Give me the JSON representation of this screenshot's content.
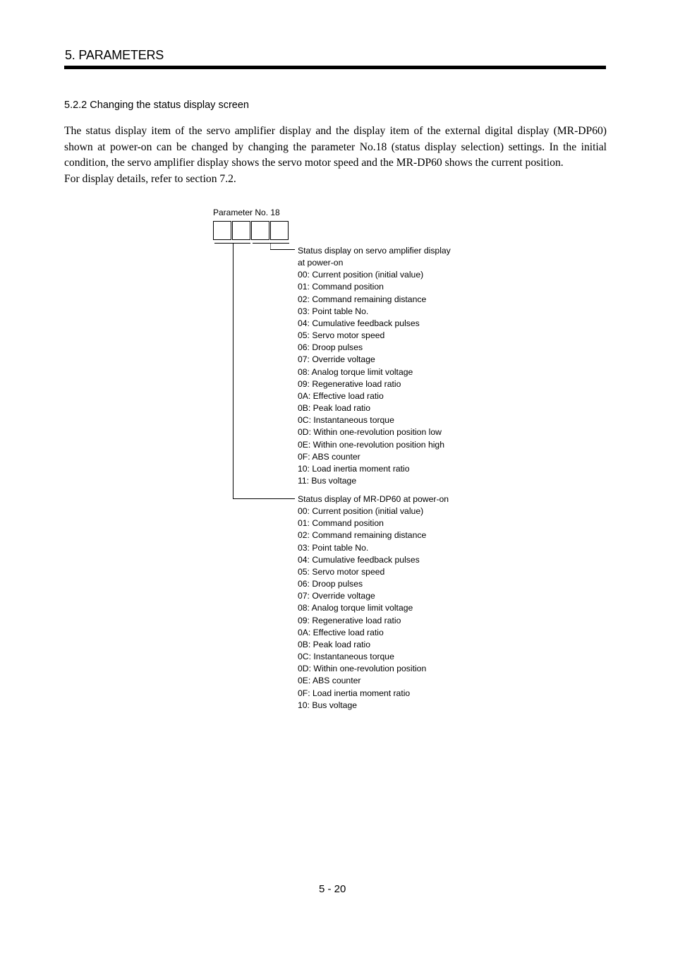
{
  "header": {
    "chapter_title": "5. PARAMETERS"
  },
  "section": {
    "title": "5.2.2 Changing the status display screen",
    "paragraph_1": "The status display item of the servo amplifier display and the display item of the external digital display (MR-DP60) shown at power-on can be changed by changing the parameter No.18 (status display selection) settings. In the initial condition, the servo amplifier display shows the servo motor speed and the MR-DP60 shows the current position.",
    "paragraph_2": "For display details, refer to section 7.2."
  },
  "diagram": {
    "parameter_label": "Parameter No. 18",
    "digit_count": 4,
    "amplifier_group": {
      "title_line_1": "Status display on servo amplifier display",
      "title_line_2": "at power-on",
      "items": [
        "00: Current position (initial value)",
        "01: Command position",
        "02: Command remaining distance",
        "03: Point table No.",
        "04: Cumulative feedback pulses",
        "05: Servo motor speed",
        "06: Droop pulses",
        "07: Override voltage",
        "08: Analog torque limit voltage",
        "09: Regenerative load ratio",
        "0A: Effective load ratio",
        "0B: Peak load ratio",
        "0C: Instantaneous torque",
        "0D: Within one-revolution position low",
        "0E: Within one-revolution position high",
        "0F: ABS counter",
        "10: Load inertia moment ratio",
        "11: Bus voltage"
      ]
    },
    "mrdp60_group": {
      "title": "Status display of MR-DP60 at power-on",
      "items": [
        "00: Current position (initial value)",
        "01: Command position",
        "02: Command remaining distance",
        "03: Point table No.",
        "04: Cumulative feedback pulses",
        "05: Servo motor speed",
        "06: Droop pulses",
        "07: Override voltage",
        "08: Analog torque limit voltage",
        "09: Regenerative load ratio",
        "0A: Effective load ratio",
        "0B: Peak load ratio",
        "0C: Instantaneous torque",
        "0D: Within one-revolution position",
        "0E: ABS counter",
        "0F: Load inertia moment ratio",
        "10: Bus voltage"
      ]
    }
  },
  "footer": {
    "page_number": "5 -  20"
  }
}
